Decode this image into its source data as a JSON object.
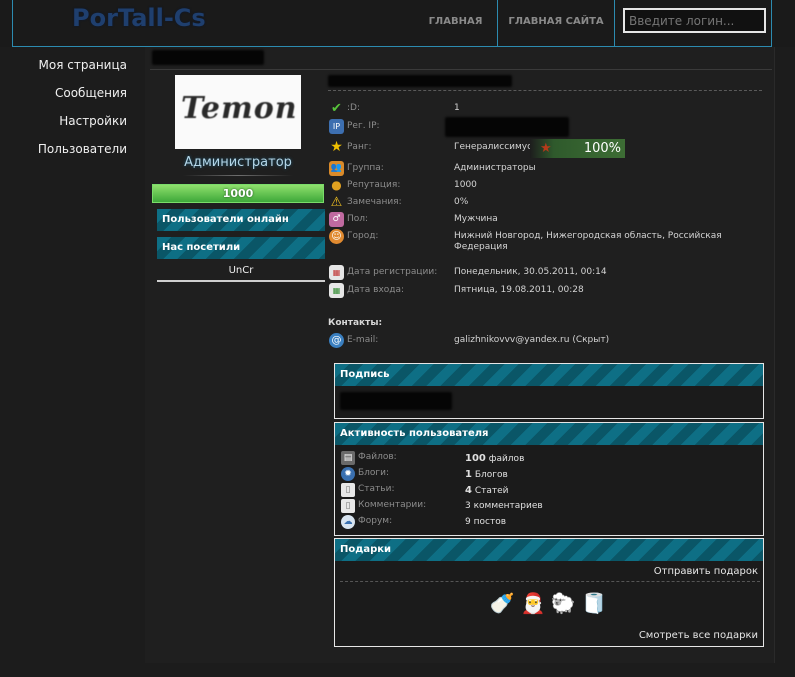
{
  "header": {
    "logo": "PorTall-Cs",
    "nav_main": "ГЛАВНАЯ",
    "nav_site": "ГЛАВНАЯ САЙТА",
    "login_placeholder": "Введите логин..."
  },
  "sidebar": {
    "items": [
      {
        "label": "Моя страница"
      },
      {
        "label": "Сообщения"
      },
      {
        "label": "Настройки"
      },
      {
        "label": "Пользователи"
      }
    ]
  },
  "profile": {
    "avatar_text": "Temon",
    "role": "Администратор",
    "reputation_bar": "1000",
    "online_users_title": "Пользователи онлайн",
    "visited_title": "Нас посетили",
    "visitor": "UnCr",
    "rank_percent": "100%",
    "contacts_title": "Контакты:",
    "info": [
      {
        "icon": "check-icon",
        "label": ":D:",
        "value": "1"
      },
      {
        "icon": "ip-icon",
        "label": "Рег. IP:",
        "value": ""
      },
      {
        "icon": "star-icon",
        "label": "Ранг:",
        "value": "Генералиссимус"
      },
      {
        "icon": "group-icon",
        "label": "Группа:",
        "value": "Администраторы"
      },
      {
        "icon": "medal-icon",
        "label": "Репутация:",
        "value": "1000"
      },
      {
        "icon": "warning-icon",
        "label": "Замечания:",
        "value": "0%"
      },
      {
        "icon": "gender-icon",
        "label": "Пол:",
        "value": "Мужчина"
      },
      {
        "icon": "city-icon",
        "label": "Город:",
        "value": "Нижний Новгород, Нижегородская область, Российская",
        "value2": "Федерация"
      },
      {
        "icon": "calendar-icon",
        "label": "Дата регистрации:",
        "value": "Понедельник, 30.05.2011, 00:14"
      },
      {
        "icon": "calendar-login-icon",
        "label": "Дата входа:",
        "value": "Пятница, 19.08.2011, 00:28"
      },
      {
        "icon": "email-icon",
        "label": "E-mail:",
        "value": "galizhnikovvv@yandex.ru (Скрыт)"
      }
    ]
  },
  "signature": {
    "title": "Подпись"
  },
  "activity": {
    "title": "Активность пользователя",
    "rows": [
      {
        "icon": "files-icon",
        "label": "Файлов:",
        "count": "100",
        "unit": "файлов"
      },
      {
        "icon": "blogs-icon",
        "label": "Блоги:",
        "count": "1",
        "unit": "Блогов"
      },
      {
        "icon": "articles-icon",
        "label": "Статьи:",
        "count": "4",
        "unit": "Статей"
      },
      {
        "icon": "comments-icon",
        "label": "Комментарии:",
        "count": "3",
        "unit": "комментариев"
      },
      {
        "icon": "forum-icon",
        "label": "Форум:",
        "count": "9",
        "unit": "постов"
      }
    ]
  },
  "gifts": {
    "title": "Подарки",
    "send_label": "Отправить подарок",
    "view_all_label": "Смотреть все подарки",
    "items": [
      {
        "icon": "bottle-icon",
        "glyph": "🍼"
      },
      {
        "icon": "santa-icon",
        "glyph": "🎅"
      },
      {
        "icon": "sheep-icon",
        "glyph": "🐑"
      },
      {
        "icon": "toilet-paper-icon",
        "glyph": "🧻"
      }
    ]
  }
}
